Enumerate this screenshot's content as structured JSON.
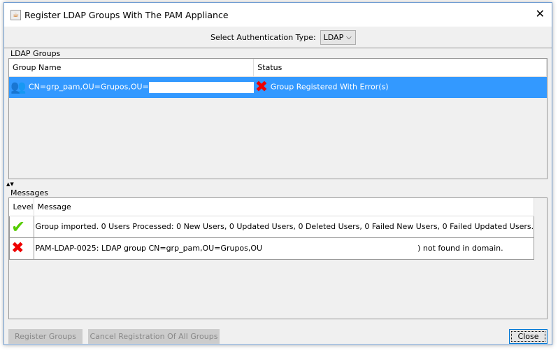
{
  "window": {
    "title": "Register LDAP Groups With The PAM Appliance",
    "close_glyph": "✕"
  },
  "auth": {
    "label": "Select Authentication Type:",
    "value": "LDAP"
  },
  "ldap_groups": {
    "label": "LDAP Groups",
    "columns": [
      "Group Name",
      "Status"
    ],
    "rows": [
      {
        "name": "CN=grp_pam,OU=Grupos,OU=",
        "status": "Group Registered With Error(s)"
      }
    ]
  },
  "messages": {
    "label": "Messages",
    "columns": [
      "Level",
      "Message"
    ],
    "rows": [
      {
        "level": "success",
        "message": "Group imported.  0 Users Processed:  0 New Users, 0 Updated Users, 0 Deleted Users, 0 Failed New Users, 0 Failed Updated Users."
      },
      {
        "level": "error",
        "message": "PAM-LDAP-0025: LDAP group CN=grp_pam,OU=Grupos,OU",
        "message_tail": ") not found in domain."
      }
    ]
  },
  "buttons": {
    "register": "Register Groups",
    "cancel": "Cancel Registration Of All Groups",
    "close": "Close"
  }
}
